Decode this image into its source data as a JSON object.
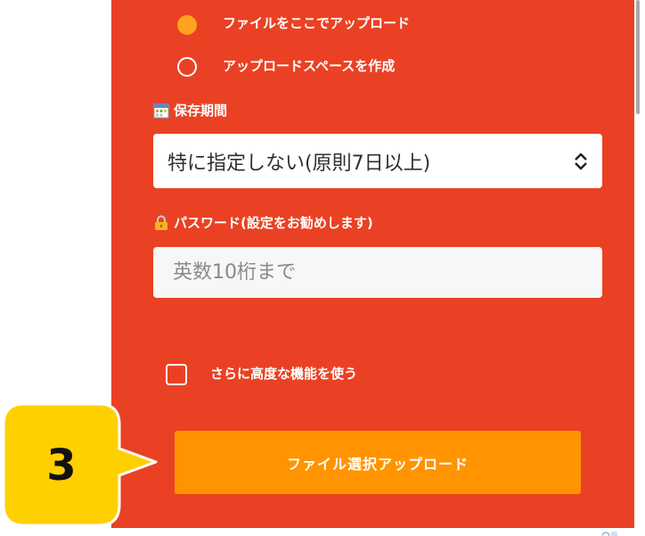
{
  "upload_options": {
    "options": [
      {
        "label": "ファイルをここでアップロード",
        "selected": true
      },
      {
        "label": "アップロードスペースを作成",
        "selected": false
      }
    ]
  },
  "retention": {
    "label": "保存期間",
    "selected_value": "特に指定しない(原則7日以上)"
  },
  "password": {
    "label": "パスワード(設定をお勧めします)",
    "placeholder": "英数10桁まで"
  },
  "advanced": {
    "label": "さらに高度な機能を使う",
    "checked": false
  },
  "upload_button": {
    "label": "ファイル選択アップロード"
  },
  "step_badge": {
    "number": "3"
  },
  "colors": {
    "panel": "#ea4124",
    "accent": "#ff9400",
    "radio_selected": "#ffa41c",
    "badge": "#ffd000"
  }
}
